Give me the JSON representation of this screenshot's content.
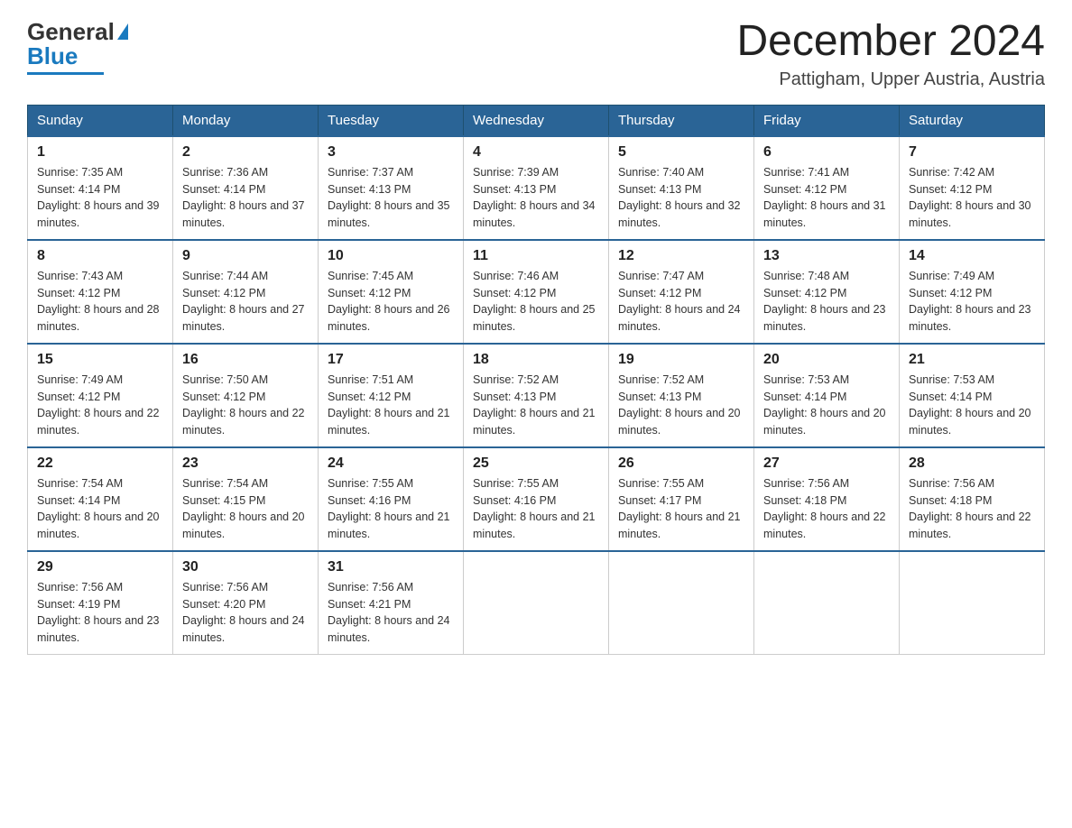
{
  "header": {
    "logo": {
      "line1": "General",
      "line2": "Blue",
      "triangle": "▶"
    },
    "title": "December 2024",
    "subtitle": "Pattigham, Upper Austria, Austria"
  },
  "calendar": {
    "days_of_week": [
      "Sunday",
      "Monday",
      "Tuesday",
      "Wednesday",
      "Thursday",
      "Friday",
      "Saturday"
    ],
    "weeks": [
      [
        {
          "day": "1",
          "sunrise": "7:35 AM",
          "sunset": "4:14 PM",
          "daylight": "8 hours and 39 minutes."
        },
        {
          "day": "2",
          "sunrise": "7:36 AM",
          "sunset": "4:14 PM",
          "daylight": "8 hours and 37 minutes."
        },
        {
          "day": "3",
          "sunrise": "7:37 AM",
          "sunset": "4:13 PM",
          "daylight": "8 hours and 35 minutes."
        },
        {
          "day": "4",
          "sunrise": "7:39 AM",
          "sunset": "4:13 PM",
          "daylight": "8 hours and 34 minutes."
        },
        {
          "day": "5",
          "sunrise": "7:40 AM",
          "sunset": "4:13 PM",
          "daylight": "8 hours and 32 minutes."
        },
        {
          "day": "6",
          "sunrise": "7:41 AM",
          "sunset": "4:12 PM",
          "daylight": "8 hours and 31 minutes."
        },
        {
          "day": "7",
          "sunrise": "7:42 AM",
          "sunset": "4:12 PM",
          "daylight": "8 hours and 30 minutes."
        }
      ],
      [
        {
          "day": "8",
          "sunrise": "7:43 AM",
          "sunset": "4:12 PM",
          "daylight": "8 hours and 28 minutes."
        },
        {
          "day": "9",
          "sunrise": "7:44 AM",
          "sunset": "4:12 PM",
          "daylight": "8 hours and 27 minutes."
        },
        {
          "day": "10",
          "sunrise": "7:45 AM",
          "sunset": "4:12 PM",
          "daylight": "8 hours and 26 minutes."
        },
        {
          "day": "11",
          "sunrise": "7:46 AM",
          "sunset": "4:12 PM",
          "daylight": "8 hours and 25 minutes."
        },
        {
          "day": "12",
          "sunrise": "7:47 AM",
          "sunset": "4:12 PM",
          "daylight": "8 hours and 24 minutes."
        },
        {
          "day": "13",
          "sunrise": "7:48 AM",
          "sunset": "4:12 PM",
          "daylight": "8 hours and 23 minutes."
        },
        {
          "day": "14",
          "sunrise": "7:49 AM",
          "sunset": "4:12 PM",
          "daylight": "8 hours and 23 minutes."
        }
      ],
      [
        {
          "day": "15",
          "sunrise": "7:49 AM",
          "sunset": "4:12 PM",
          "daylight": "8 hours and 22 minutes."
        },
        {
          "day": "16",
          "sunrise": "7:50 AM",
          "sunset": "4:12 PM",
          "daylight": "8 hours and 22 minutes."
        },
        {
          "day": "17",
          "sunrise": "7:51 AM",
          "sunset": "4:12 PM",
          "daylight": "8 hours and 21 minutes."
        },
        {
          "day": "18",
          "sunrise": "7:52 AM",
          "sunset": "4:13 PM",
          "daylight": "8 hours and 21 minutes."
        },
        {
          "day": "19",
          "sunrise": "7:52 AM",
          "sunset": "4:13 PM",
          "daylight": "8 hours and 20 minutes."
        },
        {
          "day": "20",
          "sunrise": "7:53 AM",
          "sunset": "4:14 PM",
          "daylight": "8 hours and 20 minutes."
        },
        {
          "day": "21",
          "sunrise": "7:53 AM",
          "sunset": "4:14 PM",
          "daylight": "8 hours and 20 minutes."
        }
      ],
      [
        {
          "day": "22",
          "sunrise": "7:54 AM",
          "sunset": "4:14 PM",
          "daylight": "8 hours and 20 minutes."
        },
        {
          "day": "23",
          "sunrise": "7:54 AM",
          "sunset": "4:15 PM",
          "daylight": "8 hours and 20 minutes."
        },
        {
          "day": "24",
          "sunrise": "7:55 AM",
          "sunset": "4:16 PM",
          "daylight": "8 hours and 21 minutes."
        },
        {
          "day": "25",
          "sunrise": "7:55 AM",
          "sunset": "4:16 PM",
          "daylight": "8 hours and 21 minutes."
        },
        {
          "day": "26",
          "sunrise": "7:55 AM",
          "sunset": "4:17 PM",
          "daylight": "8 hours and 21 minutes."
        },
        {
          "day": "27",
          "sunrise": "7:56 AM",
          "sunset": "4:18 PM",
          "daylight": "8 hours and 22 minutes."
        },
        {
          "day": "28",
          "sunrise": "7:56 AM",
          "sunset": "4:18 PM",
          "daylight": "8 hours and 22 minutes."
        }
      ],
      [
        {
          "day": "29",
          "sunrise": "7:56 AM",
          "sunset": "4:19 PM",
          "daylight": "8 hours and 23 minutes."
        },
        {
          "day": "30",
          "sunrise": "7:56 AM",
          "sunset": "4:20 PM",
          "daylight": "8 hours and 24 minutes."
        },
        {
          "day": "31",
          "sunrise": "7:56 AM",
          "sunset": "4:21 PM",
          "daylight": "8 hours and 24 minutes."
        },
        null,
        null,
        null,
        null
      ]
    ]
  }
}
